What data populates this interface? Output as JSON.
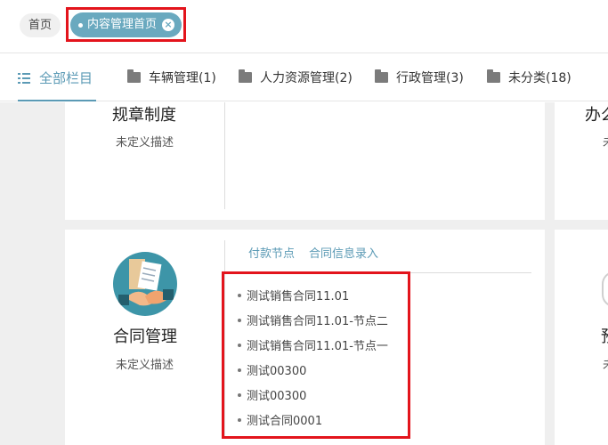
{
  "tags": {
    "home": "首页",
    "active": "内容管理首页"
  },
  "tabs": [
    {
      "label": "全部栏目"
    },
    {
      "label": "车辆管理(1)"
    },
    {
      "label": "人力资源管理(2)"
    },
    {
      "label": "行政管理(3)"
    },
    {
      "label": "未分类(18)"
    }
  ],
  "cards": {
    "rules": {
      "title": "规章制度",
      "desc": "未定义描述"
    },
    "office": {
      "title": "办么",
      "desc": "未"
    },
    "contract": {
      "title": "合同管理",
      "desc": "未定义描述",
      "links": [
        "付款节点",
        "合同信息录入"
      ],
      "items": [
        "测试销售合同11.01",
        "测试销售合同11.01-节点二",
        "测试销售合同11.01-节点一",
        "测试00300",
        "测试00300",
        "测试合同0001"
      ]
    },
    "right_partial": {
      "title": "預",
      "desc": "未"
    }
  }
}
